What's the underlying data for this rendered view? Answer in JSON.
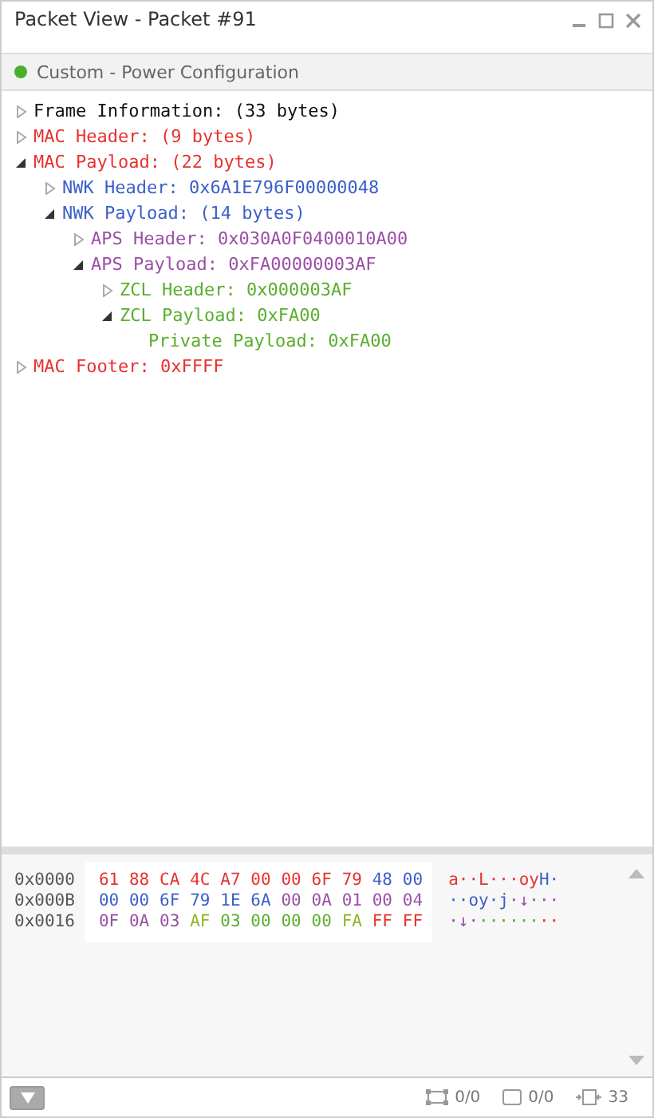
{
  "window": {
    "title": "Packet View - Packet #91"
  },
  "subtitle": {
    "text": "Custom - Power Configuration",
    "color": "#4caf2a"
  },
  "tree": [
    {
      "label": "Frame Information: (33 bytes)",
      "color": "#111111",
      "expanded": false
    },
    {
      "label": "MAC Header: (9 bytes)",
      "color": "#e8312f",
      "expanded": false
    },
    {
      "label": "MAC Payload: (22 bytes)",
      "color": "#e8312f",
      "expanded": true,
      "children": [
        {
          "label": "NWK Header: 0x6A1E796F00000048",
          "color": "#3b5fc9",
          "expanded": false
        },
        {
          "label": "NWK Payload: (14 bytes)",
          "color": "#3b5fc9",
          "expanded": true,
          "children": [
            {
              "label": "APS Header: 0x030A0F0400010A00",
              "color": "#9a4fa6",
              "expanded": false
            },
            {
              "label": "APS Payload: 0xFA00000003AF",
              "color": "#9a4fa6",
              "expanded": true,
              "children": [
                {
                  "label": "ZCL Header: 0x000003AF",
                  "color": "#5aae2e",
                  "expanded": false
                },
                {
                  "label": "ZCL Payload: 0xFA00",
                  "color": "#5aae2e",
                  "expanded": true,
                  "children": [
                    {
                      "label": "Private Payload: 0xFA00",
                      "color": "#5aae2e"
                    }
                  ]
                }
              ]
            }
          ]
        }
      ]
    },
    {
      "label": "MAC Footer: 0xFFFF",
      "color": "#e8312f",
      "expanded": false
    }
  ],
  "hex_rows": [
    {
      "offset": "0x0000",
      "bytes": [
        {
          "text": "61",
          "color": "#e8312f"
        },
        {
          "text": "88",
          "color": "#e8312f"
        },
        {
          "text": "CA",
          "color": "#e8312f"
        },
        {
          "text": "4C",
          "color": "#e8312f"
        },
        {
          "text": "A7",
          "color": "#e8312f"
        },
        {
          "text": "00",
          "color": "#e8312f"
        },
        {
          "text": "00",
          "color": "#e8312f"
        },
        {
          "text": "6F",
          "color": "#e8312f"
        },
        {
          "text": "79",
          "color": "#e8312f"
        },
        {
          "text": "48",
          "color": "#3b5fc9"
        },
        {
          "text": "00",
          "color": "#3b5fc9"
        }
      ],
      "ascii": [
        {
          "text": "a··L···oy",
          "color": "#e8312f"
        },
        {
          "text": "H·",
          "color": "#3b5fc9"
        }
      ]
    },
    {
      "offset": "0x000B",
      "bytes": [
        {
          "text": "00",
          "color": "#3b5fc9"
        },
        {
          "text": "00",
          "color": "#3b5fc9"
        },
        {
          "text": "6F",
          "color": "#3b5fc9"
        },
        {
          "text": "79",
          "color": "#3b5fc9"
        },
        {
          "text": "1E",
          "color": "#3b5fc9"
        },
        {
          "text": "6A",
          "color": "#3b5fc9"
        },
        {
          "text": "00",
          "color": "#9a4fa6"
        },
        {
          "text": "0A",
          "color": "#9a4fa6"
        },
        {
          "text": "01",
          "color": "#9a4fa6"
        },
        {
          "text": "00",
          "color": "#9a4fa6"
        },
        {
          "text": "04",
          "color": "#9a4fa6"
        }
      ],
      "ascii": [
        {
          "text": "··oy·j",
          "color": "#3b5fc9"
        },
        {
          "text": "·↓···",
          "color": "#9a4fa6"
        }
      ]
    },
    {
      "offset": "0x0016",
      "bytes": [
        {
          "text": "0F",
          "color": "#9a4fa6"
        },
        {
          "text": "0A",
          "color": "#9a4fa6"
        },
        {
          "text": "03",
          "color": "#9a4fa6"
        },
        {
          "text": "AF",
          "color": "#8fb522"
        },
        {
          "text": "03",
          "color": "#5aae2e"
        },
        {
          "text": "00",
          "color": "#5aae2e"
        },
        {
          "text": "00",
          "color": "#5aae2e"
        },
        {
          "text": "00",
          "color": "#5aae2e"
        },
        {
          "text": "FA",
          "color": "#8fb522"
        },
        {
          "text": "FF",
          "color": "#e8312f"
        },
        {
          "text": "FF",
          "color": "#e8312f"
        }
      ],
      "ascii": [
        {
          "text": "·↓·",
          "color": "#9a4fa6"
        },
        {
          "text": "······",
          "color": "#5aae2e"
        },
        {
          "text": "··",
          "color": "#e8312f"
        }
      ]
    }
  ],
  "status_bar": [
    {
      "kind": "selection",
      "text": "0/0"
    },
    {
      "kind": "frame",
      "text": "0/0"
    },
    {
      "kind": "length",
      "text": "33"
    }
  ]
}
